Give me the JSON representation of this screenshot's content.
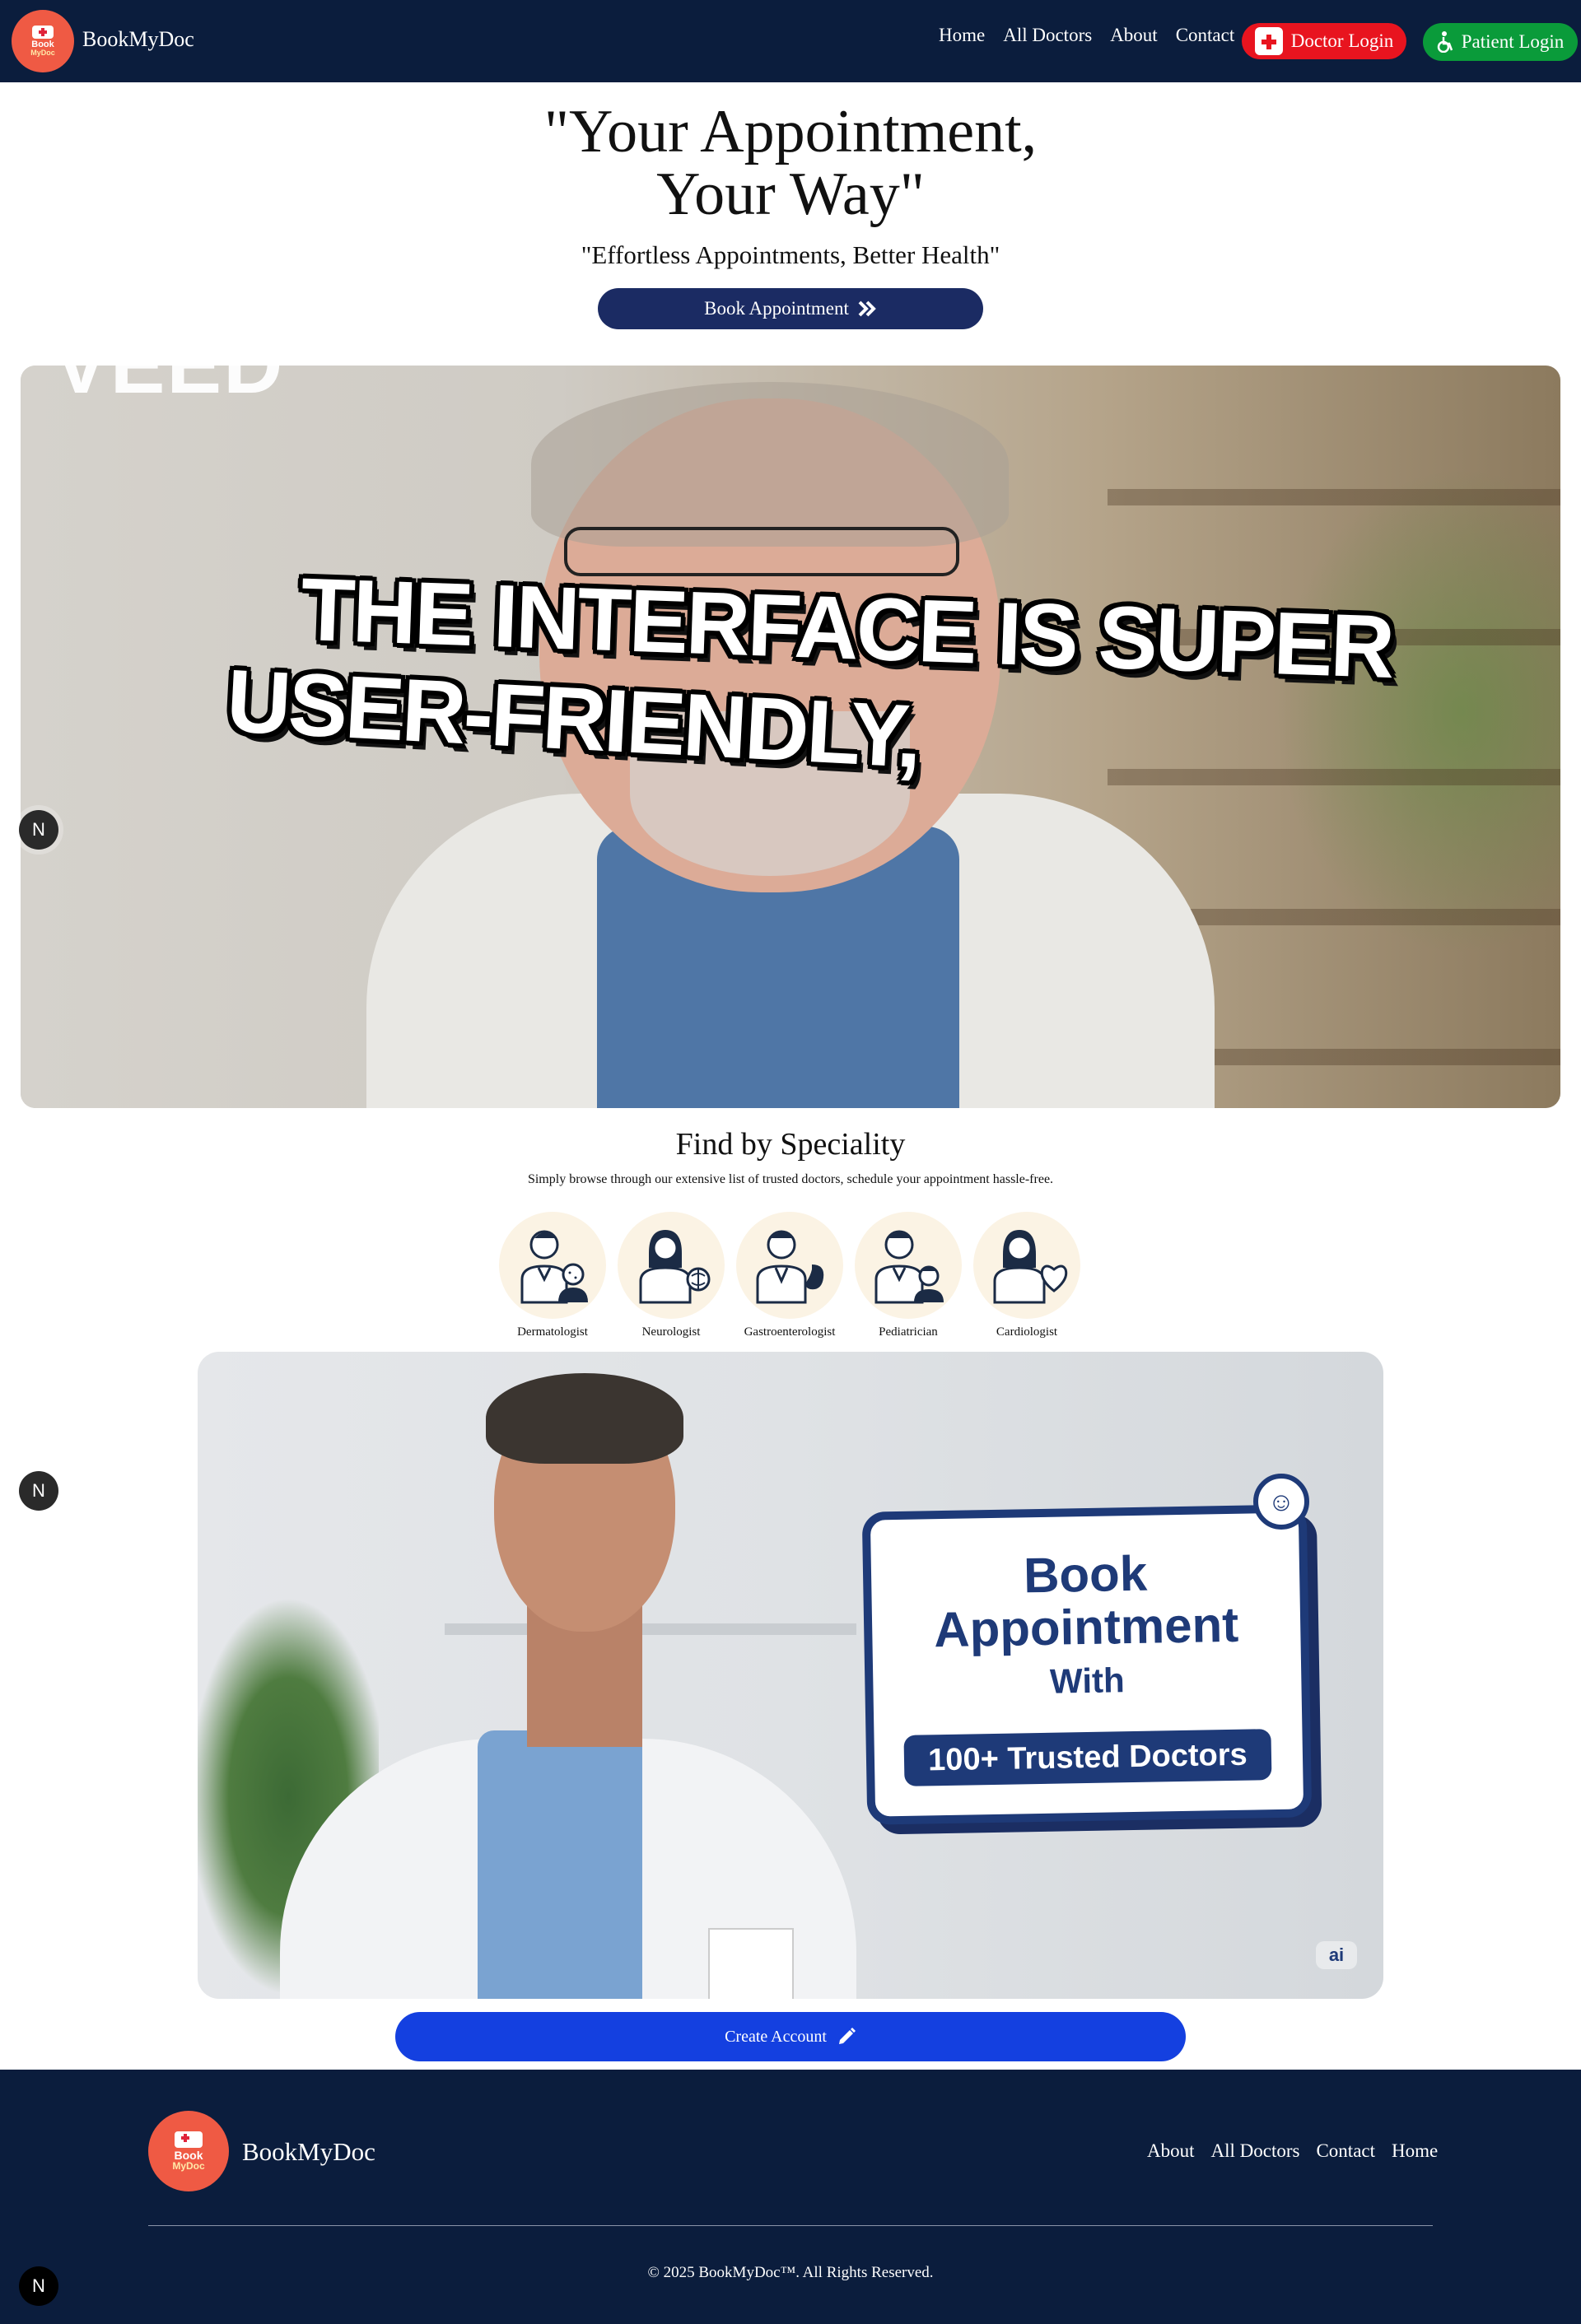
{
  "navbar": {
    "logo": {
      "line1": "Book",
      "line2": "MyDoc"
    },
    "brand": "BookMyDoc",
    "links": [
      "Home",
      "All Doctors",
      "About",
      "Contact"
    ],
    "doctor_login": "Doctor Login",
    "patient_login": "Patient Login"
  },
  "hero": {
    "title_line1": "\"Your Appointment,",
    "title_line2": "Your Way\"",
    "subtitle": "\"Effortless Appointments, Better Health\"",
    "cta": "Book Appointment"
  },
  "banner1": {
    "caption_line1": "THE INTERFACE IS SUPER",
    "caption_line2": "USER-FRIENDLY,",
    "watermark": "VEED"
  },
  "badge": "N",
  "speciality": {
    "title": "Find by Speciality",
    "description": "Simply browse through our extensive list of trusted doctors, schedule your appointment hassle-free.",
    "items": [
      {
        "label": "Dermatologist",
        "icon": "dermatologist-icon"
      },
      {
        "label": "Neurologist",
        "icon": "neurologist-icon"
      },
      {
        "label": "Gastroenterologist",
        "icon": "gastroenterologist-icon"
      },
      {
        "label": "Pediatrician",
        "icon": "pediatrician-icon"
      },
      {
        "label": "Cardiologist",
        "icon": "cardiologist-icon"
      }
    ]
  },
  "banner2": {
    "line1": "Book",
    "line2": "Appointment",
    "line3": "With",
    "pill": "100+ Trusted Doctors",
    "ai_badge": "ai",
    "name_tag": "Appointment"
  },
  "create_account": "Create Account",
  "footer": {
    "brand": "BookMyDoc",
    "links": [
      "About",
      "All Doctors",
      "Contact",
      "Home"
    ],
    "copyright": "© 2025 BookMyDoc™. All Rights Reserved."
  },
  "colors": {
    "navy": "#0b1d3d",
    "doctor_red": "#e8141f",
    "patient_green": "#0a9b3a",
    "cta_navy": "#1b2b63",
    "create_blue": "#1440e0",
    "logo_coral": "#ef5a44"
  }
}
